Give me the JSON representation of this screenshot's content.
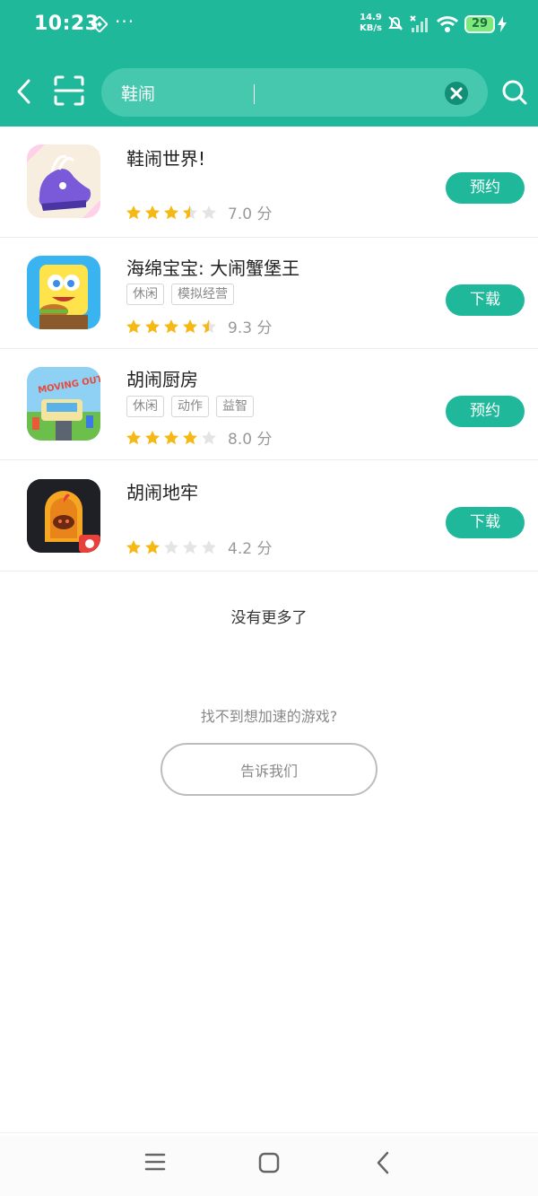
{
  "status_bar": {
    "time": "10:23",
    "dots": "···",
    "speed_value": "14.9",
    "speed_unit": "KB/s",
    "battery": "29"
  },
  "search": {
    "query": "鞋闹",
    "icons": [
      "back-arrow-icon",
      "scan-icon",
      "clear-icon",
      "search-icon"
    ]
  },
  "results": [
    {
      "name": "鞋闹世界!",
      "tags": [],
      "rating": 3.5,
      "score": "7.0 分",
      "action": "预约"
    },
    {
      "name": "海绵宝宝: 大闹蟹堡王",
      "tags": [
        "休闲",
        "模拟经营"
      ],
      "rating": 4.5,
      "score": "9.3 分",
      "action": "下载"
    },
    {
      "name": "胡闹厨房",
      "tags": [
        "休闲",
        "动作",
        "益智"
      ],
      "rating": 4,
      "score": "8.0 分",
      "action": "预约"
    },
    {
      "name": "胡闹地牢",
      "tags": [],
      "rating": 2,
      "score": "4.2 分",
      "action": "下载"
    }
  ],
  "footer": {
    "no_more": "没有更多了",
    "cant_find": "找不到想加速的游戏?",
    "tell_us": "告诉我们"
  },
  "colors": {
    "accent": "#1fb89a",
    "star": "#f5b814",
    "star_empty": "#e4e4e4"
  }
}
